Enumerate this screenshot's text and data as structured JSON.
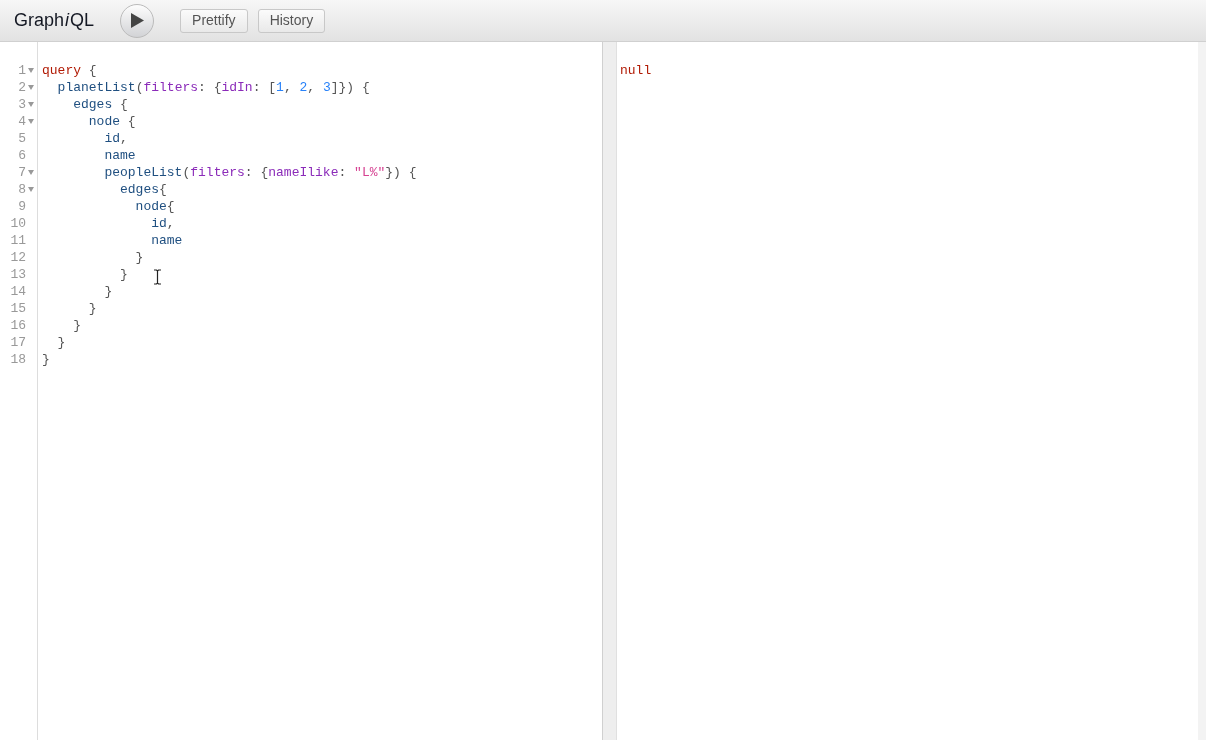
{
  "toolbar": {
    "title": [
      {
        "text": "Graph",
        "italic": false
      },
      {
        "text": "i",
        "italic": true
      },
      {
        "text": "QL",
        "italic": false
      }
    ],
    "buttons": [
      {
        "kind": "execute"
      },
      {
        "kind": "text",
        "label": "Prettify"
      },
      {
        "kind": "text",
        "label": "History"
      }
    ]
  },
  "query_editor": {
    "lines": [
      {
        "number": "1",
        "foldable": true,
        "tokens": [
          {
            "kind": "keyword",
            "text": "query"
          },
          {
            "kind": "punct",
            "text": " {"
          }
        ]
      },
      {
        "number": "2",
        "foldable": true,
        "tokens": [
          {
            "kind": "field",
            "text": "  planetList"
          },
          {
            "kind": "punct",
            "text": "("
          },
          {
            "kind": "argument",
            "text": "filters"
          },
          {
            "kind": "punct",
            "text": ": {"
          },
          {
            "kind": "argument",
            "text": "idIn"
          },
          {
            "kind": "punct",
            "text": ": ["
          },
          {
            "kind": "number",
            "text": "1"
          },
          {
            "kind": "punct",
            "text": ", "
          },
          {
            "kind": "number",
            "text": "2"
          },
          {
            "kind": "punct",
            "text": ", "
          },
          {
            "kind": "number",
            "text": "3"
          },
          {
            "kind": "punct",
            "text": "]}) {"
          }
        ]
      },
      {
        "number": "3",
        "foldable": true,
        "tokens": [
          {
            "kind": "field",
            "text": "    edges"
          },
          {
            "kind": "punct",
            "text": " {"
          }
        ]
      },
      {
        "number": "4",
        "foldable": true,
        "tokens": [
          {
            "kind": "field",
            "text": "      node"
          },
          {
            "kind": "punct",
            "text": " {"
          }
        ]
      },
      {
        "number": "5",
        "foldable": false,
        "tokens": [
          {
            "kind": "field",
            "text": "        id"
          },
          {
            "kind": "punct",
            "text": ","
          }
        ]
      },
      {
        "number": "6",
        "foldable": false,
        "tokens": [
          {
            "kind": "field",
            "text": "        name"
          }
        ]
      },
      {
        "number": "7",
        "foldable": true,
        "tokens": [
          {
            "kind": "field",
            "text": "        peopleList"
          },
          {
            "kind": "punct",
            "text": "("
          },
          {
            "kind": "argument",
            "text": "filters"
          },
          {
            "kind": "punct",
            "text": ": {"
          },
          {
            "kind": "argument",
            "text": "nameIlike"
          },
          {
            "kind": "punct",
            "text": ": "
          },
          {
            "kind": "string",
            "text": "\"L%\""
          },
          {
            "kind": "punct",
            "text": "}) {"
          }
        ]
      },
      {
        "number": "8",
        "foldable": true,
        "tokens": [
          {
            "kind": "field",
            "text": "          edges"
          },
          {
            "kind": "punct",
            "text": "{"
          }
        ]
      },
      {
        "number": "9",
        "foldable": false,
        "tokens": [
          {
            "kind": "field",
            "text": "            node"
          },
          {
            "kind": "punct",
            "text": "{"
          }
        ]
      },
      {
        "number": "10",
        "foldable": false,
        "tokens": [
          {
            "kind": "field",
            "text": "              id"
          },
          {
            "kind": "punct",
            "text": ","
          }
        ]
      },
      {
        "number": "11",
        "foldable": false,
        "tokens": [
          {
            "kind": "field",
            "text": "              name"
          }
        ]
      },
      {
        "number": "12",
        "foldable": false,
        "tokens": [
          {
            "kind": "punct",
            "text": "            }"
          }
        ]
      },
      {
        "number": "13",
        "foldable": false,
        "tokens": [
          {
            "kind": "punct",
            "text": "          }"
          }
        ]
      },
      {
        "number": "14",
        "foldable": false,
        "tokens": [
          {
            "kind": "punct",
            "text": "        }"
          }
        ]
      },
      {
        "number": "15",
        "foldable": false,
        "tokens": [
          {
            "kind": "punct",
            "text": "      }"
          }
        ]
      },
      {
        "number": "16",
        "foldable": false,
        "tokens": [
          {
            "kind": "punct",
            "text": "    }"
          }
        ]
      },
      {
        "number": "17",
        "foldable": false,
        "tokens": [
          {
            "kind": "punct",
            "text": "  }"
          }
        ]
      },
      {
        "number": "18",
        "foldable": false,
        "tokens": [
          {
            "kind": "punct",
            "text": "}"
          }
        ]
      }
    ]
  },
  "result_viewer": {
    "text": "null"
  }
}
